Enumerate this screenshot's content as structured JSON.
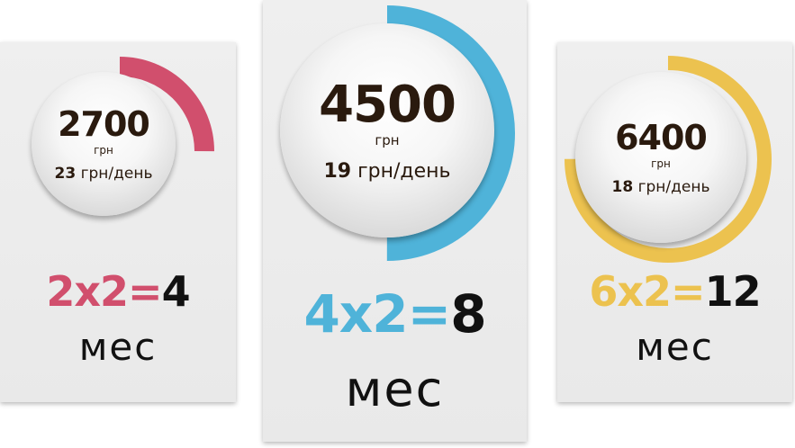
{
  "plans": [
    {
      "amount": "2700",
      "currency": "грн",
      "per_day_value": "23",
      "per_day_unit": "грн/день",
      "formula_expr": "2х2=",
      "formula_result": "4",
      "months_label": "мес",
      "accent_color": "#d14f6d",
      "ring_fraction": 0.25
    },
    {
      "amount": "4500",
      "currency": "грн",
      "per_day_value": "19",
      "per_day_unit": "грн/день",
      "formula_expr": "4х2=",
      "formula_result": "8",
      "months_label": "мес",
      "accent_color": "#4fb3d9",
      "ring_fraction": 0.5
    },
    {
      "amount": "6400",
      "currency": "грн",
      "per_day_value": "18",
      "per_day_unit": "грн/день",
      "formula_expr": "6х2=",
      "formula_result": "12",
      "months_label": "мес",
      "accent_color": "#ecc24f",
      "ring_fraction": 0.75
    }
  ]
}
